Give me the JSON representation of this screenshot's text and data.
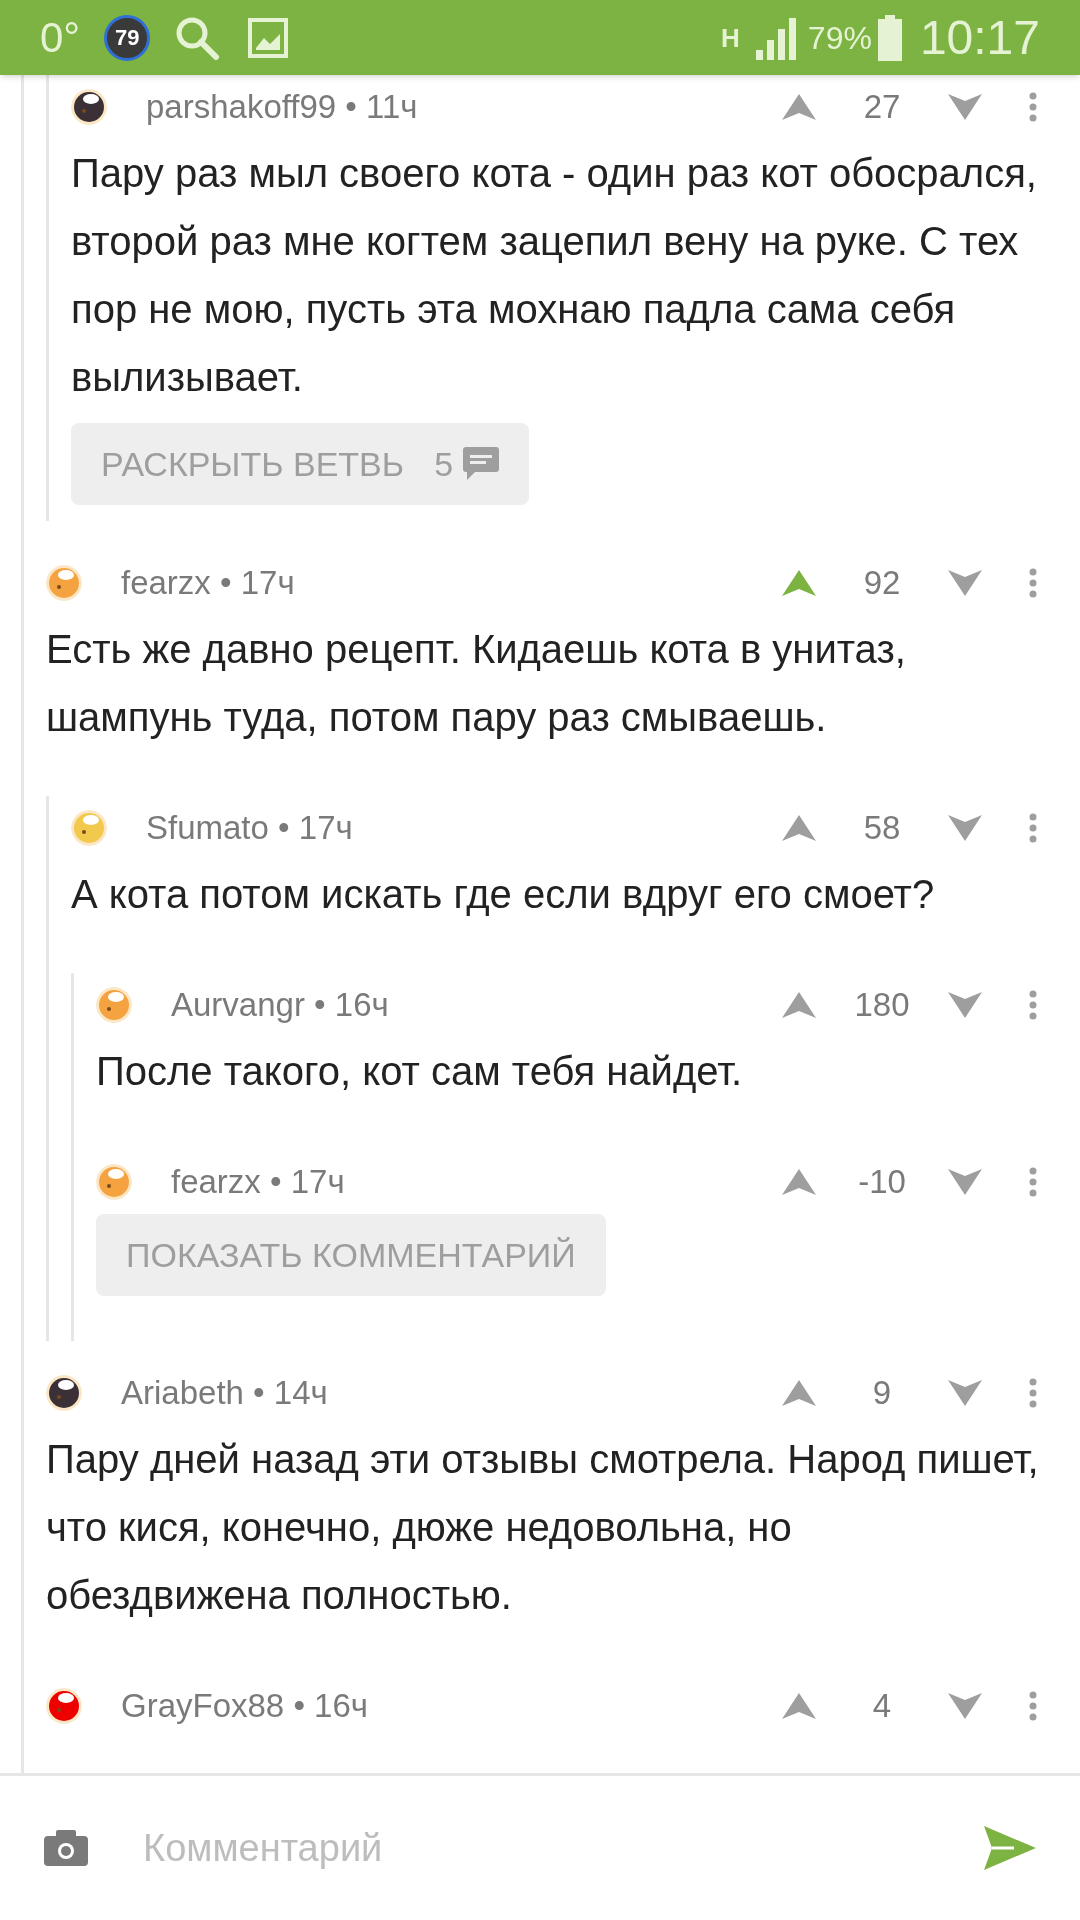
{
  "status_bar": {
    "temperature": "0°",
    "badge": "79",
    "network": "H",
    "battery": "79%",
    "time": "10:17"
  },
  "continued_replies": [
    {
      "byline": "parshakoff99 • 11ч",
      "score": "27",
      "upvoted": false,
      "color": "#3a3036",
      "text": "Пару раз мыл своего кота - один раз кот обосрался, второй раз мне когтем зацепил вену на руке. С тех пор не мою, пусть эта мохнаю падла сама себя вылизывает.",
      "expand_button": {
        "label": "РАСКРЫТЬ ВЕТВЬ",
        "count": "5"
      }
    }
  ],
  "comments": [
    {
      "byline": "fearzx • 17ч",
      "score": "92",
      "upvoted": true,
      "color": "#f4a340",
      "text": "Есть же давно рецепт. Кидаешь кота в унитаз, шампунь туда, потом пару раз смываешь.",
      "children": [
        {
          "byline": "Sfumato • 17ч",
          "score": "58",
          "upvoted": false,
          "color": "#f2c94c",
          "text": "А кота потом искать где если вдруг его смоет?",
          "children": [
            {
              "byline": "Aurvangr • 16ч",
              "score": "180",
              "upvoted": false,
              "color": "#f4a340",
              "text": "После такого, кот сам тебя найдет."
            },
            {
              "byline": "fearzx • 17ч",
              "score": "-10",
              "upvoted": false,
              "color": "#f4a340",
              "show_button": "ПОКАЗАТЬ КОММЕНТАРИЙ"
            }
          ]
        }
      ]
    },
    {
      "byline": "Ariabeth • 14ч",
      "score": "9",
      "upvoted": false,
      "color": "#3a3036",
      "text": "Пару дней назад эти отзывы смотрела. Народ пишет, что кися, конечно, дюже недовольна, но обездвижена полностью."
    },
    {
      "byline": "GrayFox88 • 16ч",
      "score": "4",
      "upvoted": false,
      "color": "#ee0000"
    }
  ],
  "composer": {
    "placeholder": "Комментарий"
  }
}
